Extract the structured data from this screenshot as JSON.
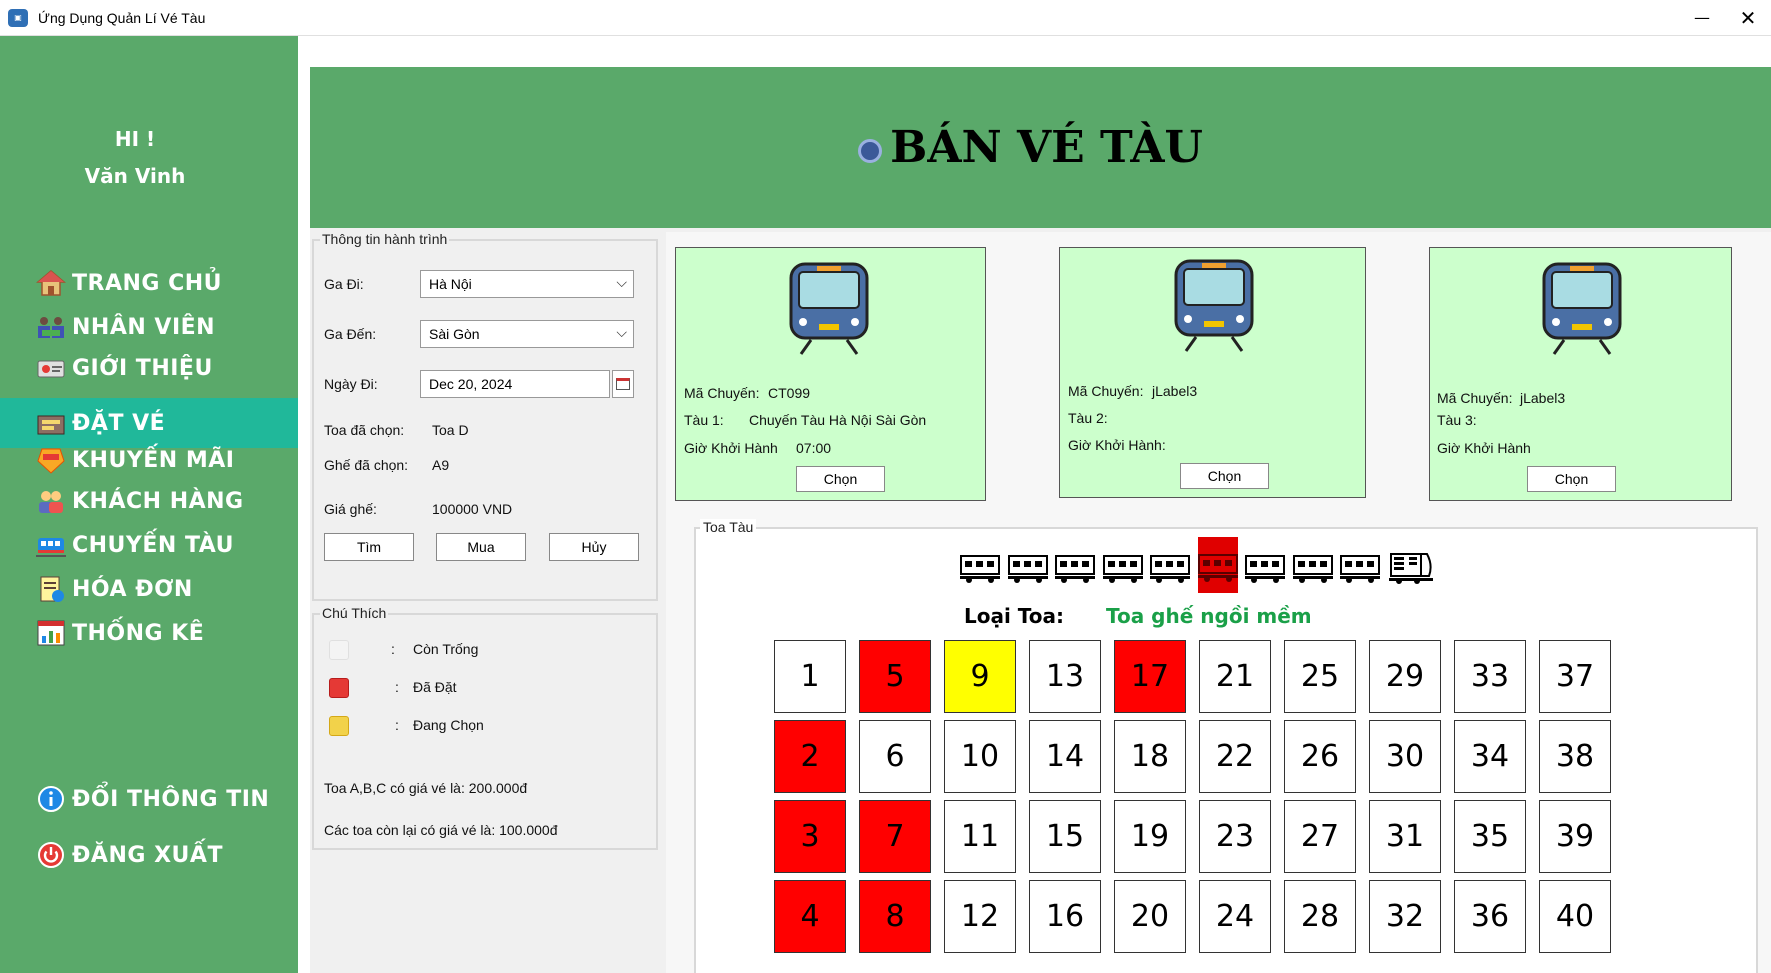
{
  "window": {
    "title": "Ứng Dụng Quản Lí Vé Tàu",
    "minimize": "—",
    "close": "✕"
  },
  "sidebar": {
    "greeting": "HI !",
    "user_name": "Văn Vinh",
    "items": [
      {
        "label": "TRANG CHỦ",
        "icon": "home-icon"
      },
      {
        "label": "NHÂN VIÊN",
        "icon": "staff-icon"
      },
      {
        "label": "GIỚI THIỆU",
        "icon": "intro-icon"
      },
      {
        "label": "ĐẶT VÉ",
        "icon": "ticket-icon",
        "active": true
      },
      {
        "label": "KHUYẾN MÃI",
        "icon": "sale-icon"
      },
      {
        "label": "KHÁCH HÀNG",
        "icon": "customers-icon"
      },
      {
        "label": "CHUYẾN TÀU",
        "icon": "train-icon"
      },
      {
        "label": "HÓA ĐƠN",
        "icon": "invoice-icon"
      },
      {
        "label": "THỐNG KÊ",
        "icon": "statistics-icon"
      }
    ],
    "change_info": "ĐỔI THÔNG TIN",
    "logout": "ĐĂNG XUẤT"
  },
  "header": {
    "title": "BÁN VÉ TÀU"
  },
  "journey": {
    "legend": "Thông tin hành trình",
    "from_label": "Ga Đi:",
    "from_value": "Hà Nội",
    "to_label": "Ga Đến:",
    "to_value": "Sài Gòn",
    "date_label": "Ngày Đi:",
    "date_value": "Dec 20, 2024",
    "car_label": "Toa đã chọn:",
    "car_value": "Toa D",
    "seat_label": "Ghế đã chọn:",
    "seat_value": "A9",
    "price_label": "Giá ghế:",
    "price_value": "100000 VND",
    "search_button": "Tìm",
    "buy_button": "Mua",
    "cancel_button": "Hủy"
  },
  "legend": {
    "title": "Chú Thích",
    "separator": ":",
    "empty_label": "Còn Trống",
    "booked_label": "Đã Đặt",
    "selecting_label": "Đang Chọn",
    "note1": "Toa A,B,C có giá vé là:  200.000đ",
    "note2": "Các toa còn lại có giá vé là:  100.000đ",
    "colors": {
      "empty": "#f4f4f4",
      "booked": "#e53935",
      "selecting": "#f2d24a"
    }
  },
  "trips": [
    {
      "code_label": "Mã Chuyến:",
      "code_value": "CT099",
      "train_label": "Tàu 1:",
      "train_value": "Chuyến Tàu Hà Nội Sài Gòn",
      "time_label": "Giờ Khởi Hành",
      "time_value": "07:00",
      "button": "Chọn"
    },
    {
      "code_label": "Mã Chuyến:",
      "code_value": "jLabel3",
      "train_label": "Tàu 2:",
      "train_value": "",
      "time_label": "Giờ Khởi Hành:",
      "time_value": "",
      "button": "Chọn"
    },
    {
      "code_label": "Mã Chuyến:",
      "code_value": "jLabel3",
      "train_label": "Tàu 3:",
      "train_value": "",
      "time_label": "Giờ Khởi Hành",
      "time_value": "",
      "button": "Chọn"
    }
  ],
  "carriages": {
    "legend": "Toa Tàu",
    "count": 9,
    "selected_index": 5,
    "type_label": "Loại Toa:",
    "type_value": "Toa ghế ngồi mềm"
  },
  "seats": {
    "booked": [
      2,
      3,
      4,
      5,
      7,
      8,
      17
    ],
    "selected": [
      9
    ],
    "colors": {
      "empty": "#ffffff",
      "booked": "#ff0000",
      "selected": "#ffff00"
    },
    "columns": [
      [
        1,
        2,
        3,
        4
      ],
      [
        5,
        6,
        7,
        8
      ],
      [
        9,
        10,
        11,
        12
      ],
      [
        13,
        14,
        15,
        16
      ],
      [
        17,
        18,
        19,
        20
      ],
      [
        21,
        22,
        23,
        24
      ],
      [
        25,
        26,
        27,
        28
      ],
      [
        29,
        30,
        31,
        32
      ],
      [
        33,
        34,
        35,
        36
      ],
      [
        37,
        38,
        39,
        40
      ]
    ]
  }
}
